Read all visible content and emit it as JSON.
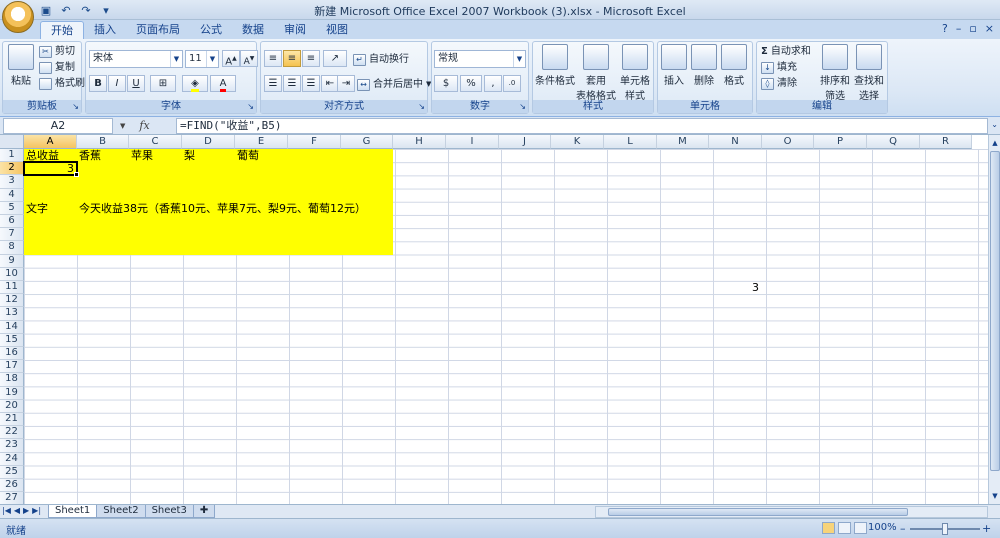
{
  "window": {
    "title": "新建 Microsoft Office Excel 2007 Workbook (3).xlsx - Microsoft Excel"
  },
  "ribbon": {
    "tabs": [
      "开始",
      "插入",
      "页面布局",
      "公式",
      "数据",
      "审阅",
      "视图"
    ],
    "clipboard": {
      "label": "剪贴板",
      "paste": "粘贴",
      "cut": "剪切",
      "copy": "复制",
      "format_painter": "格式刷"
    },
    "font": {
      "label": "字体",
      "name": "宋体",
      "size": "11"
    },
    "alignment": {
      "label": "对齐方式",
      "wrap": "自动换行",
      "merge": "合并后居中"
    },
    "number": {
      "label": "数字",
      "format": "常规"
    },
    "styles": {
      "label": "样式",
      "conditional": "条件格式",
      "table1": "套用",
      "table2": "表格格式",
      "cell1": "单元格",
      "cell2": "样式"
    },
    "cells": {
      "label": "单元格",
      "insert": "插入",
      "delete": "删除",
      "format": "格式"
    },
    "editing": {
      "label": "编辑",
      "autosum": "自动求和",
      "fill": "填充",
      "clear": "清除",
      "sort1": "排序和",
      "sort2": "筛选",
      "find1": "查找和",
      "find2": "选择"
    }
  },
  "formula_bar": {
    "name_box": "A2",
    "fx": "fx",
    "formula": "=FIND(\"收益\",B5)"
  },
  "sheet": {
    "columns": [
      "A",
      "B",
      "C",
      "D",
      "E",
      "F",
      "G",
      "H",
      "I",
      "J",
      "K",
      "L",
      "M",
      "N",
      "O",
      "P",
      "Q",
      "R"
    ],
    "rows": [
      "1",
      "2",
      "3",
      "4",
      "5",
      "6",
      "7",
      "8",
      "9",
      "10",
      "11",
      "12",
      "13",
      "14",
      "15",
      "16",
      "17",
      "18",
      "19",
      "20",
      "21",
      "22",
      "23",
      "24",
      "25",
      "26",
      "27"
    ],
    "cells": {
      "A1": "总收益",
      "B1": "香蕉",
      "C1": "苹果",
      "D1": "梨",
      "E1": "葡萄",
      "A2": "3",
      "A5": "文字",
      "B5": "今天收益38元（香蕉10元、苹果7元、梨9元、葡萄12元）",
      "N11": "3"
    },
    "fill_color": "#ffff00"
  },
  "sheet_tabs": [
    "Sheet1",
    "Sheet2",
    "Sheet3"
  ],
  "status": {
    "text": "就绪",
    "zoom": "100%"
  }
}
